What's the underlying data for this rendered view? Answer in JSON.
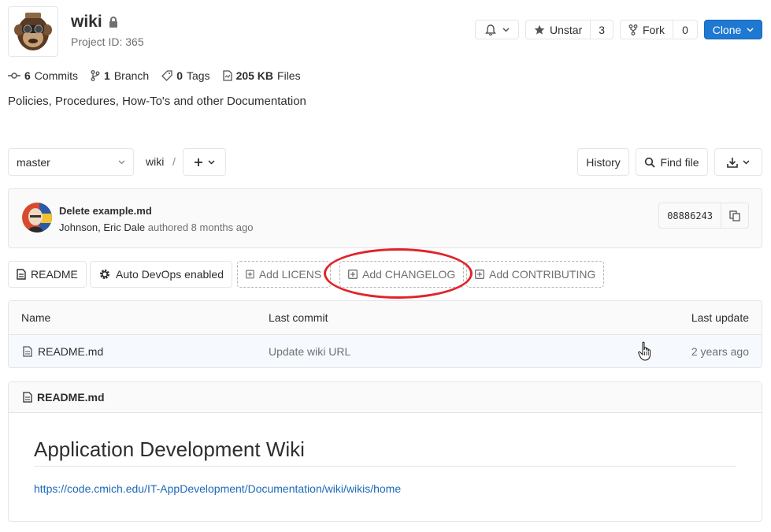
{
  "project": {
    "title": "wiki",
    "id_label": "Project ID: 365",
    "description": "Policies, Procedures, How-To's and other Documentation"
  },
  "header_actions": {
    "unstar_label": "Unstar",
    "star_count": "3",
    "fork_label": "Fork",
    "fork_count": "0",
    "clone_label": "Clone"
  },
  "stats": [
    {
      "icon": "commit-icon",
      "count": "6",
      "label": "Commits"
    },
    {
      "icon": "branch-icon",
      "count": "1",
      "label": "Branch"
    },
    {
      "icon": "tag-icon",
      "count": "0",
      "label": "Tags"
    },
    {
      "icon": "file-icon",
      "count": "205 KB",
      "label": "Files"
    }
  ],
  "tree": {
    "branch": "master",
    "breadcrumb": "wiki",
    "separator": "/",
    "history_label": "History",
    "find_file_label": "Find file"
  },
  "last_commit": {
    "title": "Delete example.md",
    "author": "Johnson, Eric Dale",
    "authored_text": "authored 8 months ago",
    "sha": "08886243"
  },
  "quick_links": {
    "readme": "README",
    "auto_devops": "Auto DevOps enabled",
    "add_license": "Add LICENSE",
    "add_changelog": "Add CHANGELOG",
    "add_contributing": "Add CONTRIBUTING"
  },
  "file_table": {
    "columns": [
      "Name",
      "Last commit",
      "Last update"
    ],
    "rows": [
      {
        "name": "README.md",
        "last_commit": "Update wiki URL",
        "last_update": "2 years ago"
      }
    ]
  },
  "readme": {
    "filename": "README.md",
    "heading": "Application Development Wiki",
    "link": "https://code.cmich.edu/IT-AppDevelopment/Documentation/wiki/wikis/home"
  },
  "colors": {
    "primary": "#1f78d1",
    "annotation": "#e0242a",
    "link": "#1b69b6"
  }
}
